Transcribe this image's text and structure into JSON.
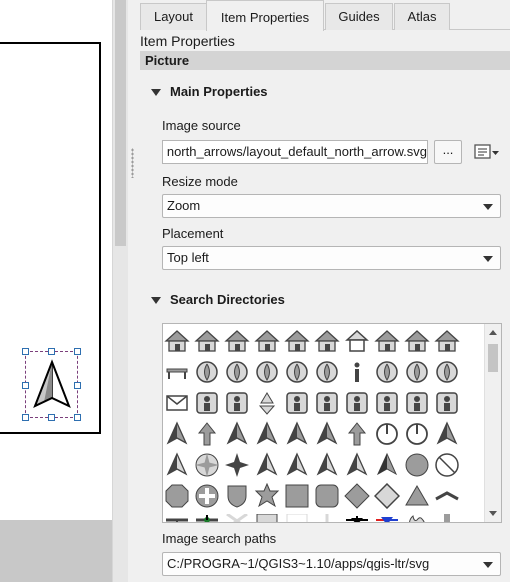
{
  "tabs": [
    "Layout",
    "Item Properties",
    "Guides",
    "Atlas"
  ],
  "panel_title": "Item Properties",
  "section": "Picture",
  "main_properties": {
    "title": "Main Properties",
    "image_source_label": "Image source",
    "image_source_value": "north_arrows/layout_default_north_arrow.svg",
    "browse_label": "...",
    "resize_mode_label": "Resize mode",
    "resize_mode_value": "Zoom",
    "placement_label": "Placement",
    "placement_value": "Top left"
  },
  "search_directories": {
    "title": "Search Directories",
    "image_search_paths_label": "Image search paths",
    "image_search_paths_value": "C:/PROGRA~1/QGIS3~1.10/apps/qgis-ltr/svg"
  },
  "colors": {
    "selection_handle": "#2e6fb0",
    "section_bar": "#d4d4d4",
    "red_arrow": "#e02020",
    "blue_arrow": "#2040d0"
  },
  "symbols": [
    "hiking-sign-icon",
    "bed-and-breakfast-icon",
    "tent-icon",
    "caravan-icon",
    "hut-icon",
    "hostel-bed-icon",
    "house-icon",
    "shelter-rain-icon",
    "shelter-icon",
    "village-icon",
    "bench-icon",
    "scales-icon",
    "fire-icon",
    "fire-station-icon",
    "fire-hydrant-icon",
    "fountain-icon",
    "info-icon",
    "book-icon",
    "wc-icon",
    "no-smoking-icon",
    "mail-icon",
    "post-office-icon",
    "phone-booth-icon",
    "recycle-icon",
    "survey-point-icon",
    "telephone-icon",
    "toilets-icon",
    "wheelchair-wc-icon",
    "male-wc-icon",
    "female-wc-icon",
    "walker-icon",
    "arrow-up-icon",
    "north-arrow-icon",
    "north-arrow-half-icon",
    "north-needle-icon",
    "north-arrow-wide-icon",
    "north-arrow-thin-icon",
    "compass-north-icon",
    "compass-circle-icon",
    "compass-diamond-icon",
    "north-arrow-outline-icon",
    "compass-rose-icon",
    "four-point-star-icon",
    "compass-cross-icon",
    "needle-icon",
    "north-arrow-filled-icon",
    "north-arrow-star-icon",
    "north-arrow-color-icon",
    "circle-icon",
    "circle-slash-icon",
    "octagon-icon",
    "cross-shield-icon",
    "shield-icon",
    "star-badge-icon",
    "square-icon",
    "rounded-square-icon",
    "diamond-icon",
    "diamond-outline-icon",
    "triangle-icon",
    "chevron-icon"
  ]
}
